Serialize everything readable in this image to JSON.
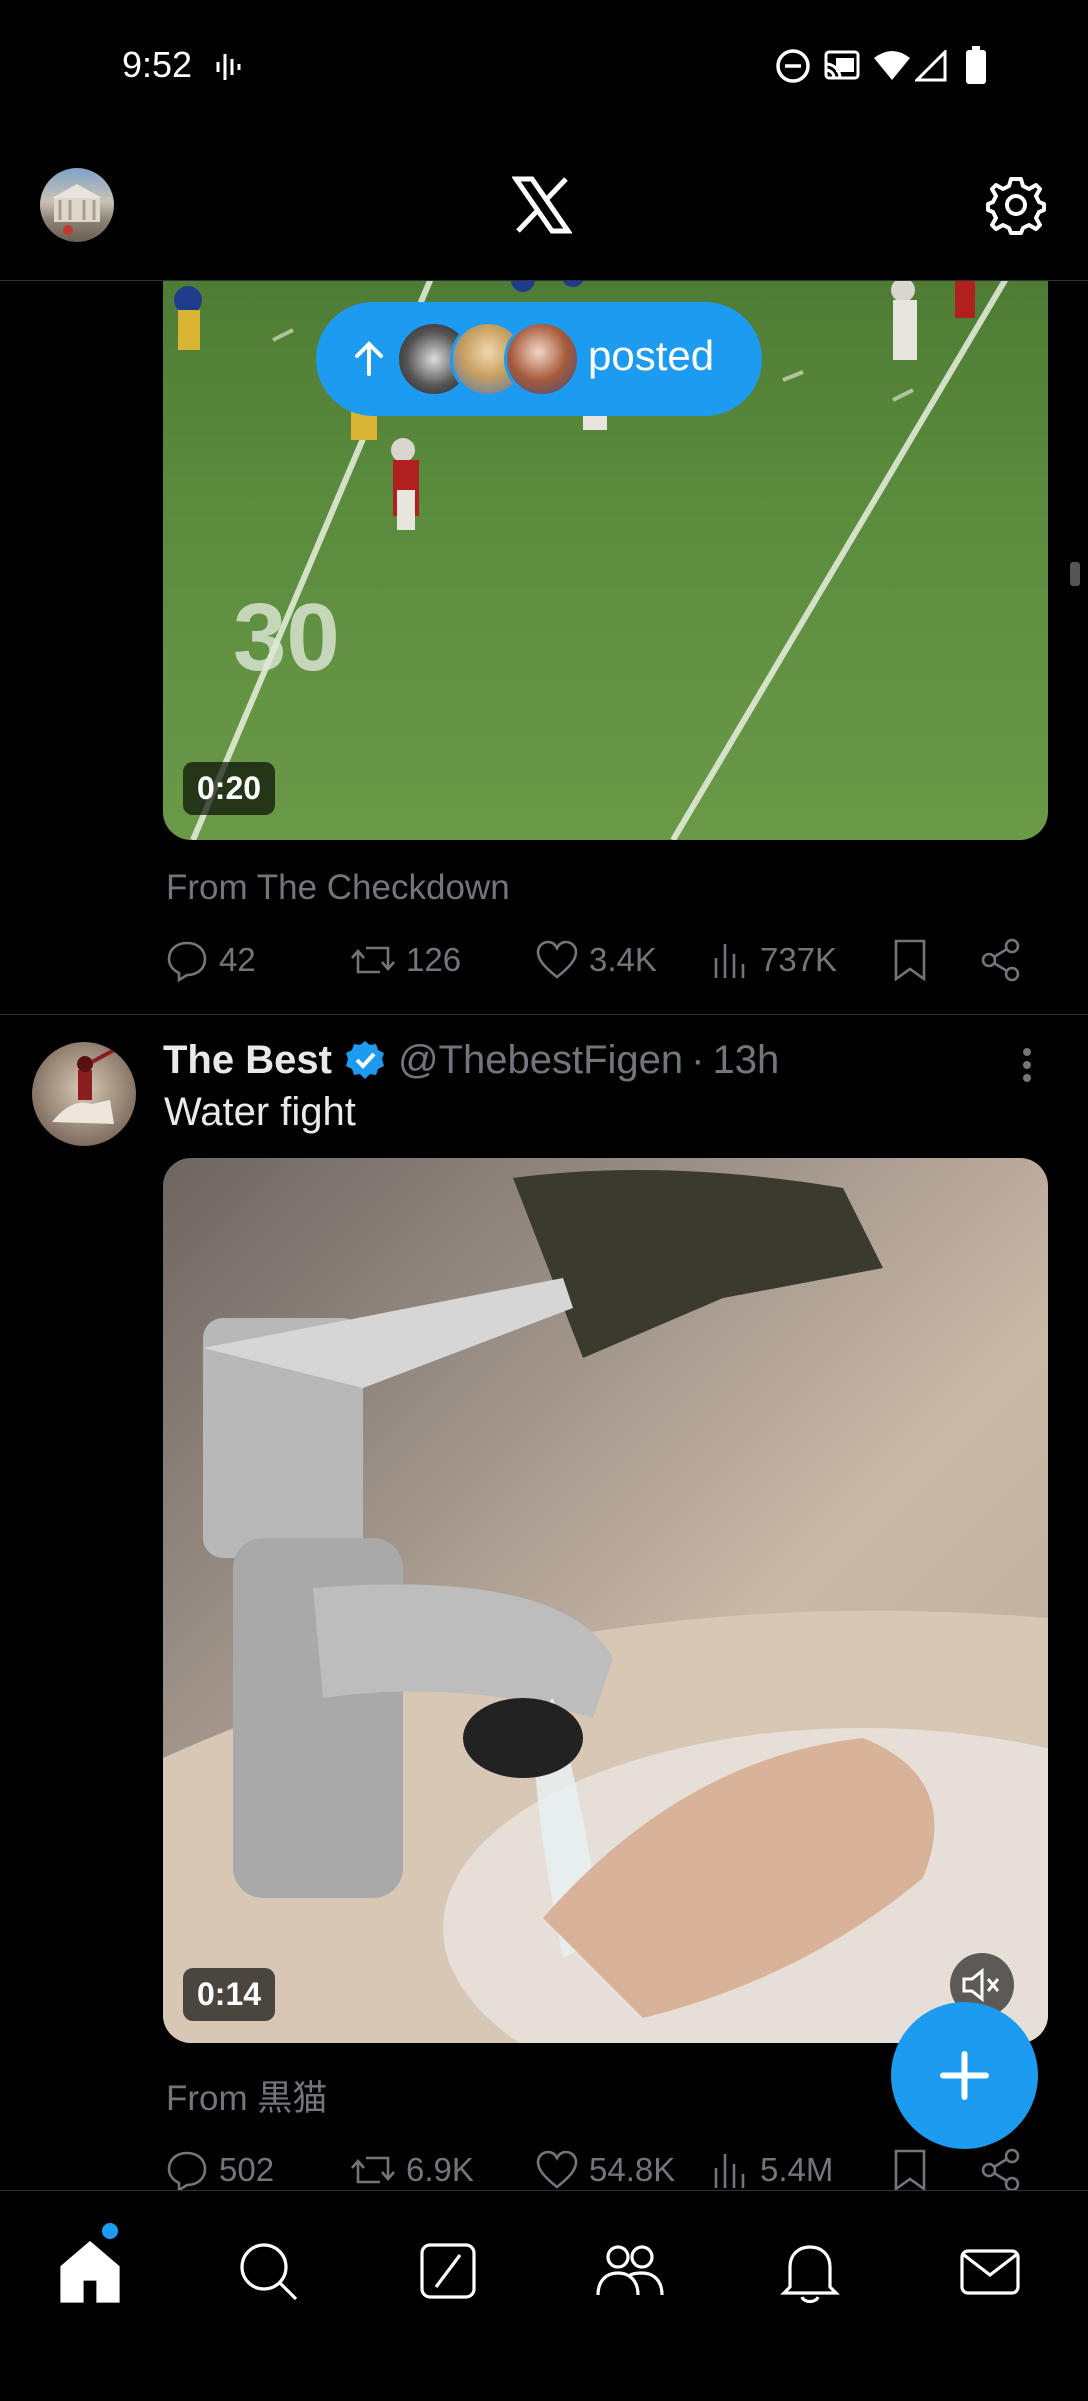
{
  "status_bar": {
    "time": "9:52"
  },
  "header": {
    "logo": "X"
  },
  "new_posts_pill": {
    "label": "posted"
  },
  "tweet1": {
    "video_duration": "0:20",
    "source": "From The Checkdown",
    "replies": "42",
    "reposts": "126",
    "likes": "3.4K",
    "views": "737K"
  },
  "tweet2": {
    "display_name": "The Best",
    "handle": "@ThebestFigen",
    "dot": "·",
    "time": "13h",
    "text": "Water fight",
    "video_duration": "0:14",
    "source": "From 黒猫",
    "replies": "502",
    "reposts": "6.9K",
    "likes": "54.8K",
    "views": "5.4M"
  },
  "icons": {
    "settings": "gear-icon",
    "fab": "plus-icon",
    "nav": [
      "home-icon",
      "search-icon",
      "grok-icon",
      "communities-icon",
      "notifications-icon",
      "messages-icon"
    ]
  },
  "colors": {
    "accent": "#1d9bf0",
    "background": "#000000",
    "muted_text": "#71767b"
  }
}
